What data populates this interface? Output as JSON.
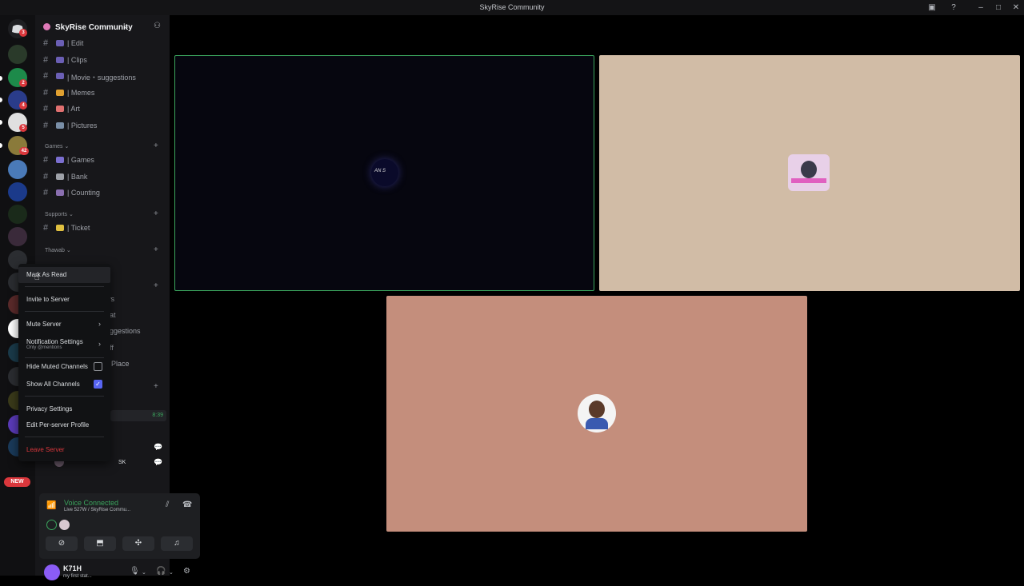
{
  "window": {
    "title": "SkyRise Community"
  },
  "server": {
    "name": "SkyRise Community"
  },
  "rail_badges": [
    "3",
    "2",
    "4",
    "5",
    "42"
  ],
  "new_badge": "NEW",
  "channels_top": [
    {
      "name": "| Edit",
      "color": "#6b5fb5"
    },
    {
      "name": "| Clips",
      "color": "#6b5fb5"
    },
    {
      "name": "| Movie・suggestions",
      "color": "#6b5fb5"
    },
    {
      "name": "| Memes",
      "color": "#e0a030"
    },
    {
      "name": "| Art",
      "color": "#e07070"
    },
    {
      "name": "| Pictures",
      "color": "#7a8fa8"
    }
  ],
  "categories": {
    "games": "Games",
    "supports": "Supports",
    "thawab": "Thawab"
  },
  "channels_games": [
    {
      "name": "| Games",
      "color": "#7b6fd0"
    },
    {
      "name": "| Bank",
      "color": "#9ea1a8"
    },
    {
      "name": "| Counting",
      "color": "#8a6fb0"
    }
  ],
  "channels_supports": [
    {
      "name": "| Ticket",
      "color": "#e0c040"
    }
  ],
  "partial_channels": [
    "ws",
    "hat",
    "uggestions",
    "aff",
    "Place"
  ],
  "partial_time": "8:39",
  "partial_user": "SK",
  "context_menu": {
    "mark_as_read": "Mark As Read",
    "invite": "Invite to Server",
    "mute": "Mute Server",
    "notifications": "Notification Settings",
    "notifications_sub": "Only @mentions",
    "hide_muted": "Hide Muted Channels",
    "show_all": "Show All Channels",
    "privacy": "Privacy Settings",
    "edit_profile": "Edit Per-server Profile",
    "leave": "Leave Server"
  },
  "voice": {
    "status": "Voice Connected",
    "channel": "Live 527W / SkyRise Commu..."
  },
  "user": {
    "name": "K71H",
    "status": "my first stat..."
  },
  "tile_labels": {
    "t1": "AN S"
  },
  "colors": {
    "accent": "#5865f2",
    "speaking": "#3ba55d",
    "danger": "#da373c"
  }
}
